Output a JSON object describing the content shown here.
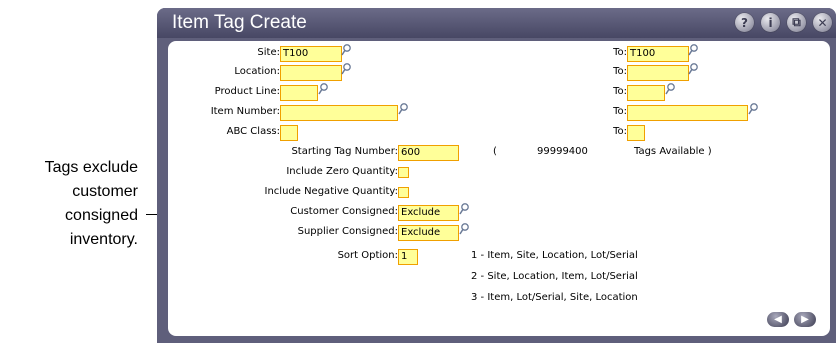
{
  "callout": {
    "lines": [
      "Tags exclude",
      "customer",
      "consigned",
      "inventory."
    ]
  },
  "window": {
    "title": "Item Tag Create",
    "icons": [
      "help-icon",
      "info-icon",
      "restore-icon",
      "close-icon"
    ],
    "icon_glyphs": {
      "help": "?",
      "info": "i",
      "restore": "⧉",
      "close": "✕"
    }
  },
  "form": {
    "site": {
      "label": "Site:",
      "value": "T100",
      "to_label": "To:",
      "to_value": "T100"
    },
    "location": {
      "label": "Location:",
      "value": "",
      "to_label": "To:",
      "to_value": ""
    },
    "product_line": {
      "label": "Product Line:",
      "value": "",
      "to_label": "To:",
      "to_value": ""
    },
    "item_number": {
      "label": "Item Number:",
      "value": "",
      "to_label": "To:",
      "to_value": ""
    },
    "abc_class": {
      "label": "ABC Class:",
      "value": "",
      "to_label": "To:",
      "to_value": ""
    },
    "starting_tag": {
      "label": "Starting Tag Number:",
      "value": "600",
      "paren_open": "(",
      "available_count": "99999400",
      "available_text": "Tags Available )"
    },
    "include_zero": {
      "label": "Include Zero Quantity:",
      "value": ""
    },
    "include_negative": {
      "label": "Include Negative Quantity:",
      "value": ""
    },
    "customer_consigned": {
      "label": "Customer Consigned:",
      "value": "Exclude"
    },
    "supplier_consigned": {
      "label": "Supplier Consigned:",
      "value": "Exclude"
    },
    "sort_option": {
      "label": "Sort Option:",
      "value": "1"
    },
    "sort_choices": [
      "1 - Item, Site, Location, Lot/Serial",
      "2 - Site, Location, Item, Lot/Serial",
      "3 - Item, Lot/Serial, Site, Location"
    ]
  },
  "nav": {
    "back_glyph": "◀",
    "forward_glyph": "▶"
  },
  "colors": {
    "field_bg": "#ffff99",
    "field_border": "#f0a000",
    "window_frame": "#5f5f7b"
  }
}
